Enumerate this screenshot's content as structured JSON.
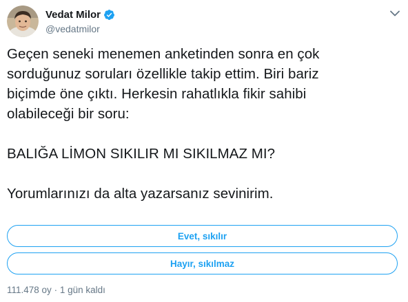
{
  "author": {
    "display_name": "Vedat Milor",
    "handle": "@vedatmilor",
    "verified": true,
    "avatar_icon": "profile-photo"
  },
  "tweet": {
    "paragraphs": [
      "Geçen seneki menemen anketinden sonra en çok\nsorduğunuz soruları özellikle takip ettim. Biri bariz\nbiçimde öne çıktı. Herkesin rahatlıkla fikir sahibi\nolabileceği bir soru:",
      "BALIĞA LİMON SIKILIR MI SIKILMAZ MI?",
      "Yorumlarınızı da alta yazarsanız sevinirim."
    ]
  },
  "poll": {
    "options": [
      "Evet, sıkılır",
      "Hayır, sıkılmaz"
    ],
    "votes": "111.478 oy",
    "separator": "·",
    "time_left": "1 gün kaldı"
  },
  "colors": {
    "accent": "#1da1f2",
    "text": "#14171a",
    "muted": "#657786"
  },
  "icons": {
    "verified": "verified-badge-icon",
    "menu": "chevron-down-icon"
  }
}
